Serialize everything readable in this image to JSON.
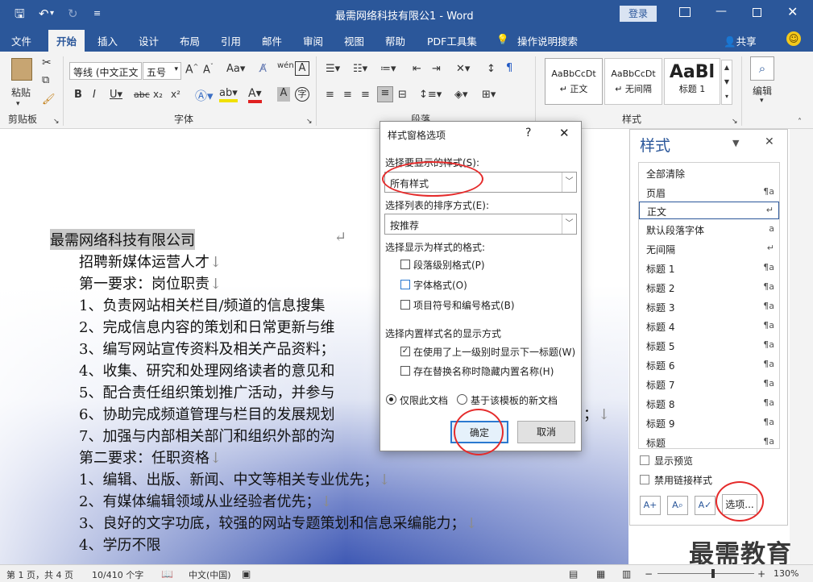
{
  "titlebar": {
    "save_icon": "save-icon",
    "undo_icon": "undo-icon",
    "redo_icon": "redo-icon",
    "title": "最需网络科技有限公1 - Word",
    "login_label": "登录",
    "accent": "#2b579a"
  },
  "tabs": [
    {
      "label": "文件"
    },
    {
      "label": "开始"
    },
    {
      "label": "插入"
    },
    {
      "label": "设计"
    },
    {
      "label": "布局"
    },
    {
      "label": "引用"
    },
    {
      "label": "邮件"
    },
    {
      "label": "审阅"
    },
    {
      "label": "视图"
    },
    {
      "label": "帮助"
    },
    {
      "label": "PDF工具集"
    },
    {
      "label": "操作说明搜索"
    },
    {
      "label": "共享"
    }
  ],
  "ribbon": {
    "paste_label": "粘贴",
    "clipboard_label": "剪贴板",
    "font_name": "等线 (中文正文",
    "font_size": "五号",
    "font_label": "字体",
    "paragraph_label": "段落",
    "styles_label": "样式",
    "edit_label": "编辑",
    "style_previews": [
      {
        "preview": "AaBbCcDt",
        "name": "正文"
      },
      {
        "preview": "AaBbCcDt",
        "name": "无间隔"
      },
      {
        "preview": "AaBl",
        "name": "标题 1"
      }
    ]
  },
  "document": {
    "lines": [
      "最需网络科技有限公司",
      "招聘新媒体运营人才",
      "第一要求：岗位职责",
      "1、负责网站相关栏目/频道的信息搜集",
      "2、完成信息内容的策划和日常更新与维",
      "3、编写网站宣传资料及相关产品资料；",
      "4、收集、研究和处理网络读者的意见和",
      "5、配合责任组织策划推广活动，并参与",
      "6、协助完成频道管理与栏目的发展规划",
      "7、加强与内部相关部门和组织外部的沟",
      "第二要求：任职资格",
      "1、编辑、出版、新闻、中文等相关专业优先；",
      "2、有媒体编辑领域从业经验者优先；",
      "3、良好的文字功底，较强的网站专题策划和信息采编能力；",
      "4、学历不限"
    ],
    "para_mark": "↵",
    "line_mark": "↓"
  },
  "dialog": {
    "title": "样式窗格选项",
    "help": "?",
    "close": "✕",
    "show_label": "选择要显示的样式(S):",
    "show_value": "所有样式",
    "sort_label": "选择列表的排序方式(E):",
    "sort_value": "按推荐",
    "format_label": "选择显示为样式的格式:",
    "format_options": [
      {
        "label": "段落级别格式(P)",
        "checked": false
      },
      {
        "label": "字体格式(O)",
        "checked": false
      },
      {
        "label": "项目符号和编号格式(B)",
        "checked": false
      }
    ],
    "builtin_label": "选择内置样式名的显示方式",
    "builtin_options": [
      {
        "label": "在使用了上一级别时显示下一标题(W)",
        "checked": true
      },
      {
        "label": "存在替换名称时隐藏内置名称(H)",
        "checked": false
      }
    ],
    "scope_options": [
      {
        "label": "仅限此文档",
        "selected": true
      },
      {
        "label": "基于该模板的新文档",
        "selected": false
      }
    ],
    "ok_label": "确定",
    "cancel_label": "取消"
  },
  "styles_pane": {
    "title": "样式",
    "items": [
      {
        "name": "全部清除",
        "mark": ""
      },
      {
        "name": "页眉",
        "mark": "¶a"
      },
      {
        "name": "正文",
        "mark": "↵"
      },
      {
        "name": "默认段落字体",
        "mark": "a"
      },
      {
        "name": "无间隔",
        "mark": "↵"
      },
      {
        "name": "标题 1",
        "mark": "¶a"
      },
      {
        "name": "标题 2",
        "mark": "¶a"
      },
      {
        "name": "标题 3",
        "mark": "¶a"
      },
      {
        "name": "标题 4",
        "mark": "¶a"
      },
      {
        "name": "标题 5",
        "mark": "¶a"
      },
      {
        "name": "标题 6",
        "mark": "¶a"
      },
      {
        "name": "标题 7",
        "mark": "¶a"
      },
      {
        "name": "标题 8",
        "mark": "¶a"
      },
      {
        "name": "标题 9",
        "mark": "¶a"
      },
      {
        "name": "标题",
        "mark": "¶a"
      }
    ],
    "show_preview": "显示预览",
    "disable_linked": "禁用链接样式",
    "options_label": "选项..."
  },
  "status": {
    "page": "第 1 页，共 4 页",
    "words": "10/410 个字",
    "language": "中文(中国)",
    "zoom": "130%"
  },
  "watermark": "最需教育"
}
